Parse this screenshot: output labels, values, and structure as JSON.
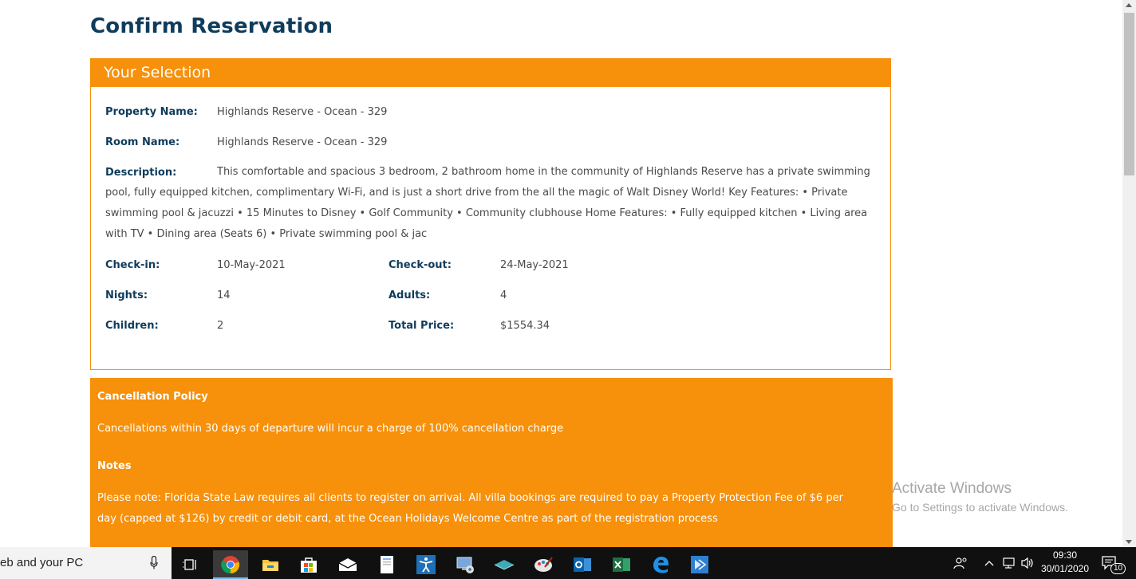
{
  "page": {
    "title": "Confirm Reservation"
  },
  "selection": {
    "header": "Your Selection",
    "property_name_label": "Property Name:",
    "property_name": "Highlands Reserve - Ocean - 329",
    "room_name_label": "Room Name:",
    "room_name": "Highlands Reserve - Ocean - 329",
    "description_label": "Description:",
    "description": "This comfortable and spacious 3 bedroom, 2 bathroom home in the community of Highlands Reserve has a private swimming pool, fully equipped kitchen, complimentary Wi-Fi, and is just a short drive from the all the magic of Walt Disney World! Key Features: • Private swimming pool & jacuzzi • 15 Minutes to Disney • Golf Community • Community clubhouse Home Features: • Fully equipped kitchen • Living area with TV • Dining area (Seats 6) • Private swimming pool & jac",
    "checkin_label": "Check-in:",
    "checkin": "10-May-2021",
    "checkout_label": "Check-out:",
    "checkout": "24-May-2021",
    "nights_label": "Nights:",
    "nights": "14",
    "adults_label": "Adults:",
    "adults": "4",
    "children_label": "Children:",
    "children": "2",
    "total_label": "Total Price:",
    "total": "$1554.34"
  },
  "policy": {
    "cancel_title": "Cancellation Policy",
    "cancel_text": "Cancellations within 30 days of departure will incur a charge of 100% cancellation charge",
    "notes_title": "Notes",
    "notes_text": "Please note: Florida State Law requires all clients to register on arrival. All villa bookings are required to pay a Property Protection Fee of $6 per day (capped at $126) by credit or debit card, at the Ocean Holidays Welcome Centre as part of the registration process"
  },
  "watermark": {
    "title": "Activate Windows",
    "subtitle": "Go to Settings to activate Windows."
  },
  "taskbar": {
    "search_text": "eb and your PC",
    "time": "09:30",
    "date": "30/01/2020",
    "notification_count": "10",
    "icons": [
      "microphone-icon",
      "task-view-icon",
      "chrome-icon",
      "file-explorer-icon",
      "store-icon",
      "mail-icon",
      "document-icon",
      "accessibility-icon",
      "remote-desktop-icon",
      "layers-icon",
      "paint-icon",
      "outlook-icon",
      "excel-icon",
      "edge-icon",
      "powerautomate-icon"
    ]
  },
  "colors": {
    "accent": "#f7900a",
    "title": "#0f3c5c"
  }
}
